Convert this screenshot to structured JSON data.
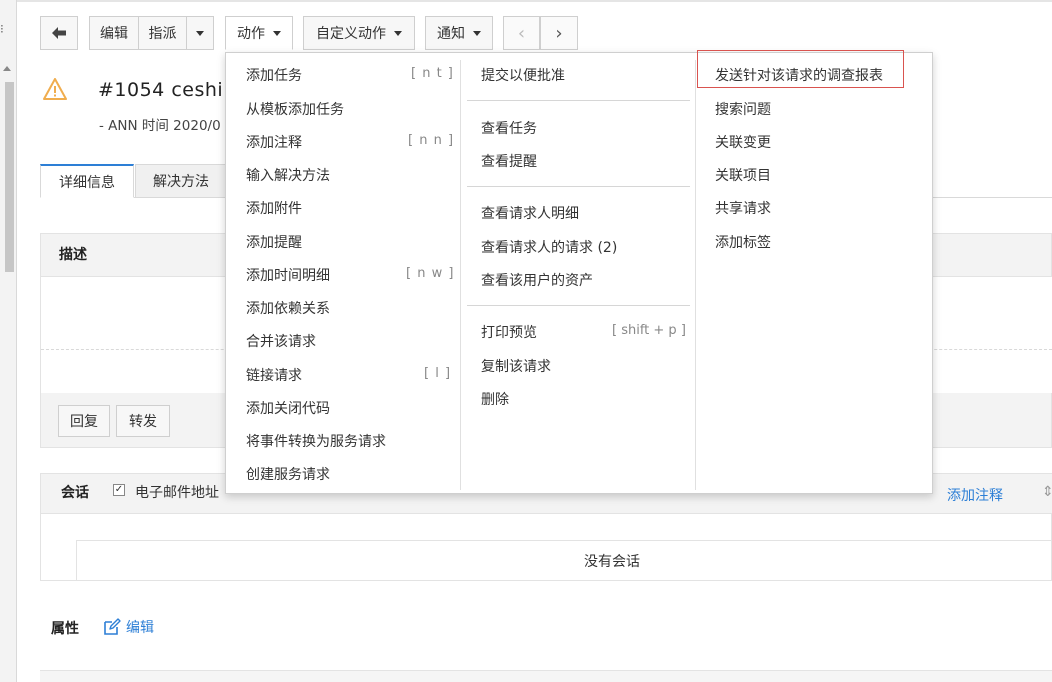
{
  "toolbar": {
    "edit": "编辑",
    "assign": "指派",
    "actions": "动作",
    "custom_actions": "自定义动作",
    "notify": "通知"
  },
  "request": {
    "title": "#1054  ceshi",
    "meta": "- ANN 时间 2020/0"
  },
  "tabs": [
    "详细信息",
    "解决方法"
  ],
  "description": {
    "title": "描述",
    "reply": "回复",
    "forward": "转发"
  },
  "conversation": {
    "title": "会话",
    "email_label": "电子邮件地址",
    "add_note": "添加注释",
    "empty": "没有会话"
  },
  "properties": {
    "title": "属性",
    "edit": "编辑"
  },
  "menu": {
    "col1": [
      {
        "label": "添加任务",
        "shortcut": "[ n t ]"
      },
      {
        "label": "从模板添加任务",
        "shortcut": ""
      },
      {
        "label": "添加注释",
        "shortcut": "[ n n ]"
      },
      {
        "label": "输入解决方法",
        "shortcut": ""
      },
      {
        "label": "添加附件",
        "shortcut": ""
      },
      {
        "label": "添加提醒",
        "shortcut": ""
      },
      {
        "label": "添加时间明细",
        "shortcut": "[ n w ]"
      },
      {
        "label": "添加依赖关系",
        "shortcut": ""
      },
      {
        "label": "合并该请求",
        "shortcut": ""
      },
      {
        "label": "链接请求",
        "shortcut": "[ l ]"
      },
      {
        "label": "添加关闭代码",
        "shortcut": ""
      },
      {
        "label": "将事件转换为服务请求",
        "shortcut": ""
      },
      {
        "label": "创建服务请求",
        "shortcut": ""
      }
    ],
    "col2": [
      {
        "label": "提交以便批准",
        "shortcut": ""
      },
      {
        "label": "查看任务",
        "shortcut": ""
      },
      {
        "label": "查看提醒",
        "shortcut": ""
      },
      {
        "label": "查看请求人明细",
        "shortcut": ""
      },
      {
        "label": "查看请求人的请求 (2)",
        "shortcut": ""
      },
      {
        "label": "查看该用户的资产",
        "shortcut": ""
      },
      {
        "label": "打印预览",
        "shortcut": "[ shift + p ]"
      },
      {
        "label": "复制该请求",
        "shortcut": ""
      },
      {
        "label": "删除",
        "shortcut": ""
      }
    ],
    "col3": [
      {
        "label": "发送针对该请求的调查报表"
      },
      {
        "label": "搜索问题"
      },
      {
        "label": "关联变更"
      },
      {
        "label": "关联项目"
      },
      {
        "label": "共享请求"
      },
      {
        "label": "添加标签"
      }
    ]
  },
  "colors": {
    "accent": "#2d7fd6",
    "warning": "#f0ad4e",
    "highlight_border": "#d9534f"
  }
}
